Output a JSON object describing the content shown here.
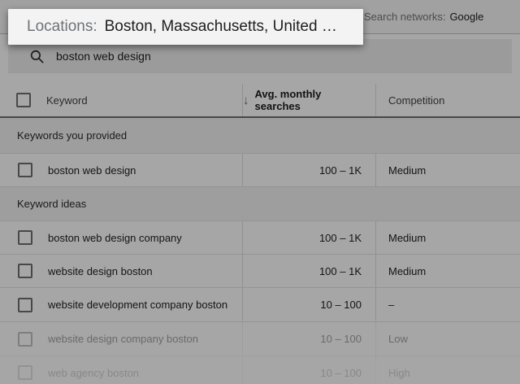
{
  "colors": {
    "overlay": "rgba(0,0,0,0.35)",
    "callout_background": "#f3f3f3",
    "text_primary": "#212121",
    "text_secondary": "#757575",
    "divider": "#e4e4e4",
    "header_rule": "#6e6e6e",
    "search_field_background": "#efefef"
  },
  "toolbar": {
    "search_networks_label": "Search networks:",
    "search_networks_value": "Google"
  },
  "callout": {
    "label": "Locations:",
    "value": "Boston, Massachusetts, United …"
  },
  "search": {
    "value": "boston web design",
    "icon": "search-icon"
  },
  "table": {
    "header": {
      "keyword": "Keyword",
      "searches": "Avg. monthly searches",
      "competition": "Competition",
      "sort_glyph": "↓",
      "sort_icon": "arrow-down-icon"
    },
    "sections": [
      {
        "title": "Keywords you provided",
        "rows": [
          {
            "keyword": "boston web design",
            "searches": "100 – 1K",
            "competition": "Medium"
          }
        ]
      },
      {
        "title": "Keyword ideas",
        "rows": [
          {
            "keyword": "boston web design company",
            "searches": "100 – 1K",
            "competition": "Medium"
          },
          {
            "keyword": "website design boston",
            "searches": "100 – 1K",
            "competition": "Medium"
          },
          {
            "keyword": "website development company boston",
            "searches": "10 – 100",
            "competition": "–"
          },
          {
            "keyword": "website design company boston",
            "searches": "10 – 100",
            "competition": "Low"
          },
          {
            "keyword": "web agency boston",
            "searches": "10 – 100",
            "competition": "High"
          }
        ]
      }
    ]
  }
}
